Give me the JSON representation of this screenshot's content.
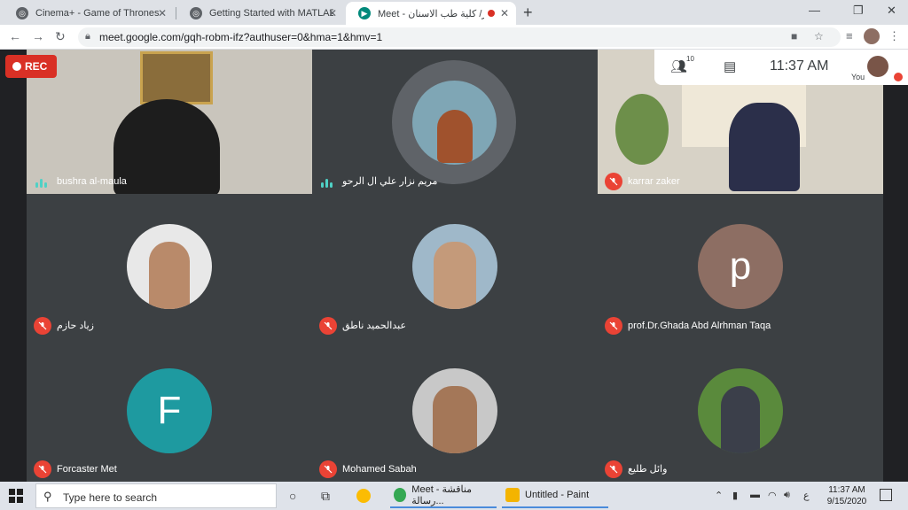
{
  "browser": {
    "tabs": [
      {
        "title": "Cinema+ - Game of Thrones"
      },
      {
        "title": "Getting Started with MATLAB_A"
      },
      {
        "title": "Meet - ماجستير/ كلية طب الاسنان"
      }
    ],
    "url": "meet.google.com/gqh-robm-ifz?authuser=0&hma=1&hmv=1"
  },
  "meet": {
    "rec_label": "REC",
    "participant_count": "10",
    "time": "11:37 AM",
    "you_label": "You",
    "participants": [
      {
        "name": "bushra al-maula",
        "mic": "on"
      },
      {
        "name": "مريم نزار علي ال الرحو",
        "mic": "on"
      },
      {
        "name": "karrar zaker",
        "mic": "off"
      },
      {
        "name": "زياد حازم",
        "mic": "off"
      },
      {
        "name": "عبدالحميد ناطق",
        "mic": "off"
      },
      {
        "name": "prof.Dr.Ghada Abd Alrhman Taqa",
        "mic": "off",
        "initial": "p",
        "color": "#8d6e63"
      },
      {
        "name": "Forcaster Met",
        "mic": "off",
        "initial": "F",
        "color": "#1e9aa0"
      },
      {
        "name": "Mohamed Sabah",
        "mic": "off"
      },
      {
        "name": "وائل طليع",
        "mic": "off"
      }
    ]
  },
  "taskbar": {
    "search_placeholder": "Type here to search",
    "apps": [
      {
        "label": "Meet - مناقشة رسالة..."
      },
      {
        "label": "Untitled - Paint"
      }
    ],
    "clock_time": "11:37 AM",
    "clock_date": "9/15/2020",
    "lang": "ع"
  }
}
